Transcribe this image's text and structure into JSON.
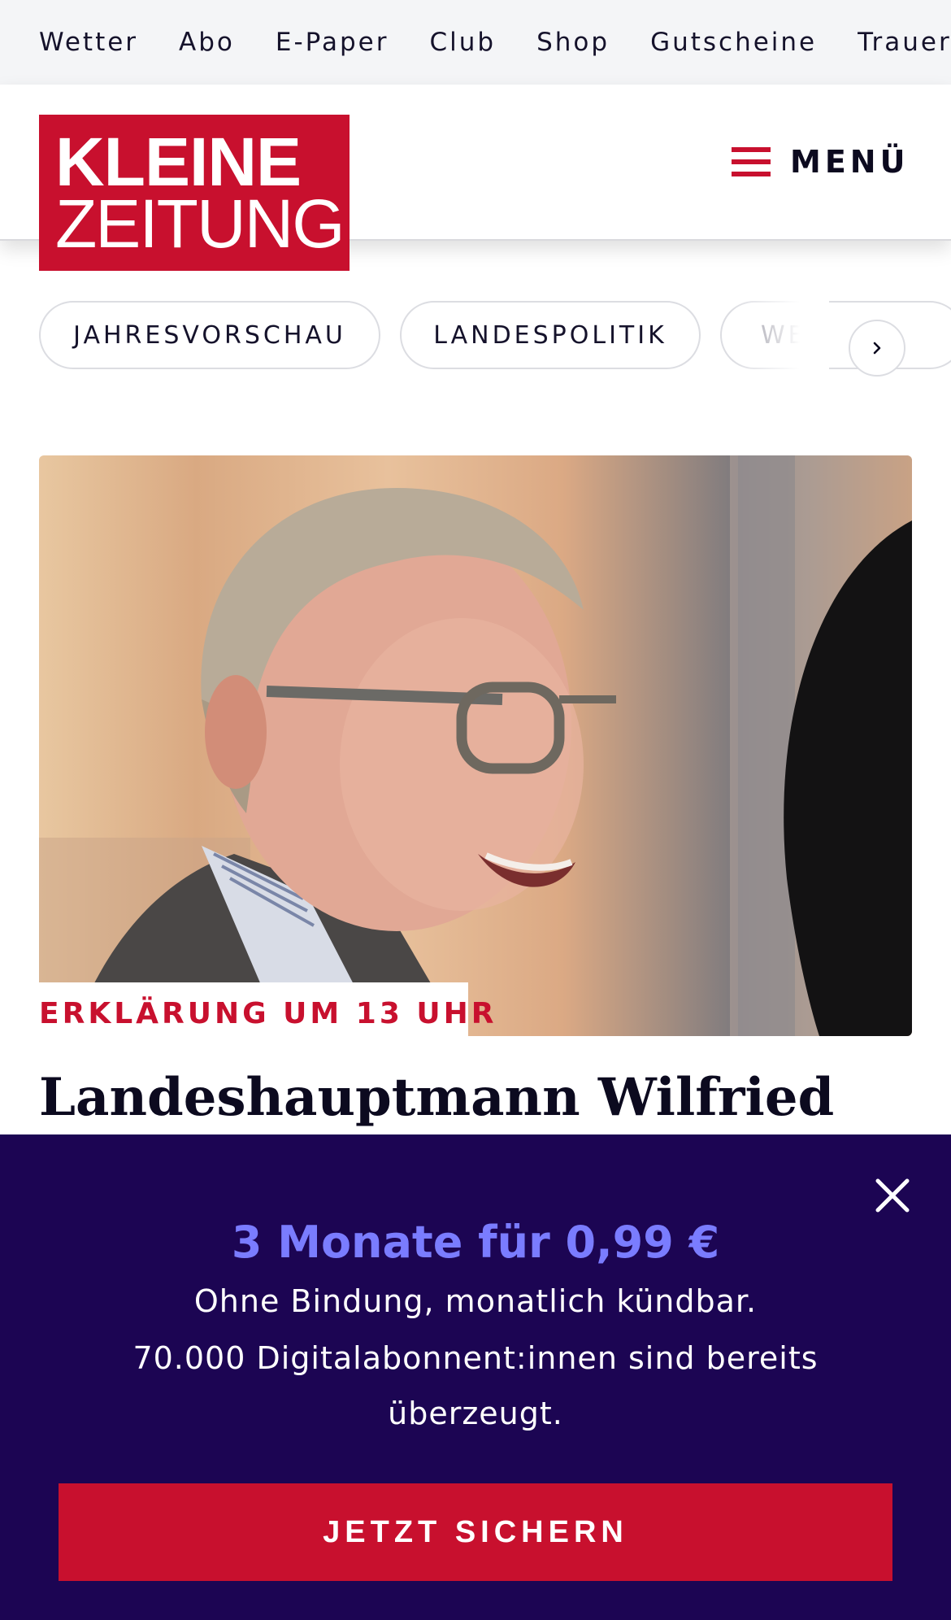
{
  "topnav": {
    "items": [
      "Wetter",
      "Abo",
      "E-Paper",
      "Club",
      "Shop",
      "Gutscheine",
      "Trauerp"
    ]
  },
  "header": {
    "logo_line1": "KLEINE",
    "logo_line2": "ZEITUNG",
    "menu_label": "MENÜ"
  },
  "topics": {
    "pills": [
      "JAHRESVORSCHAU",
      "LANDESPOLITIK",
      "WE"
    ],
    "next_icon": "chevron-right-icon"
  },
  "article": {
    "kicker": "ERKLÄRUNG UM 13 UHR",
    "headline": "Landeshauptmann Wilfried"
  },
  "promo": {
    "title": "3 Monate für 0,99 €",
    "line1": "Ohne Bindung, monatlich kündbar.",
    "line2": "70.000 Digitalabonnent:innen sind bereits",
    "line3": "überzeugt.",
    "cta_label": "JETZT SICHERN",
    "close_icon": "close-icon"
  },
  "colors": {
    "brand_red": "#c8102e",
    "promo_bg": "#1c0553",
    "promo_accent": "#7a7cff"
  }
}
